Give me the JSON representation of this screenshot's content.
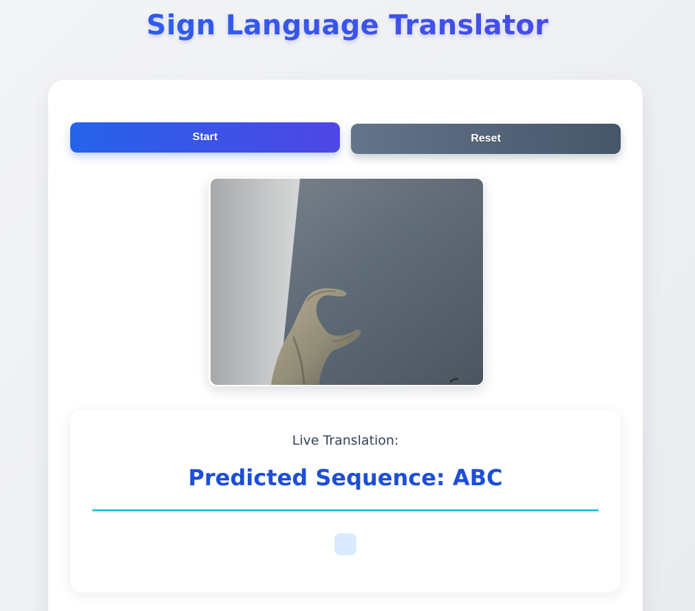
{
  "app": {
    "title": "Sign Language Translator"
  },
  "controls": {
    "start_label": "Start",
    "reset_label": "Reset"
  },
  "video": {
    "label": "webcam-feed"
  },
  "translation": {
    "label": "Live Translation:",
    "result": "Predicted Sequence: ABC"
  },
  "colors": {
    "accent_primary": "#2563eb",
    "accent_secondary": "#4f46e5",
    "reset_button": "#64748b",
    "underline": "#22c7e0",
    "result_text": "#1d4ed8"
  }
}
